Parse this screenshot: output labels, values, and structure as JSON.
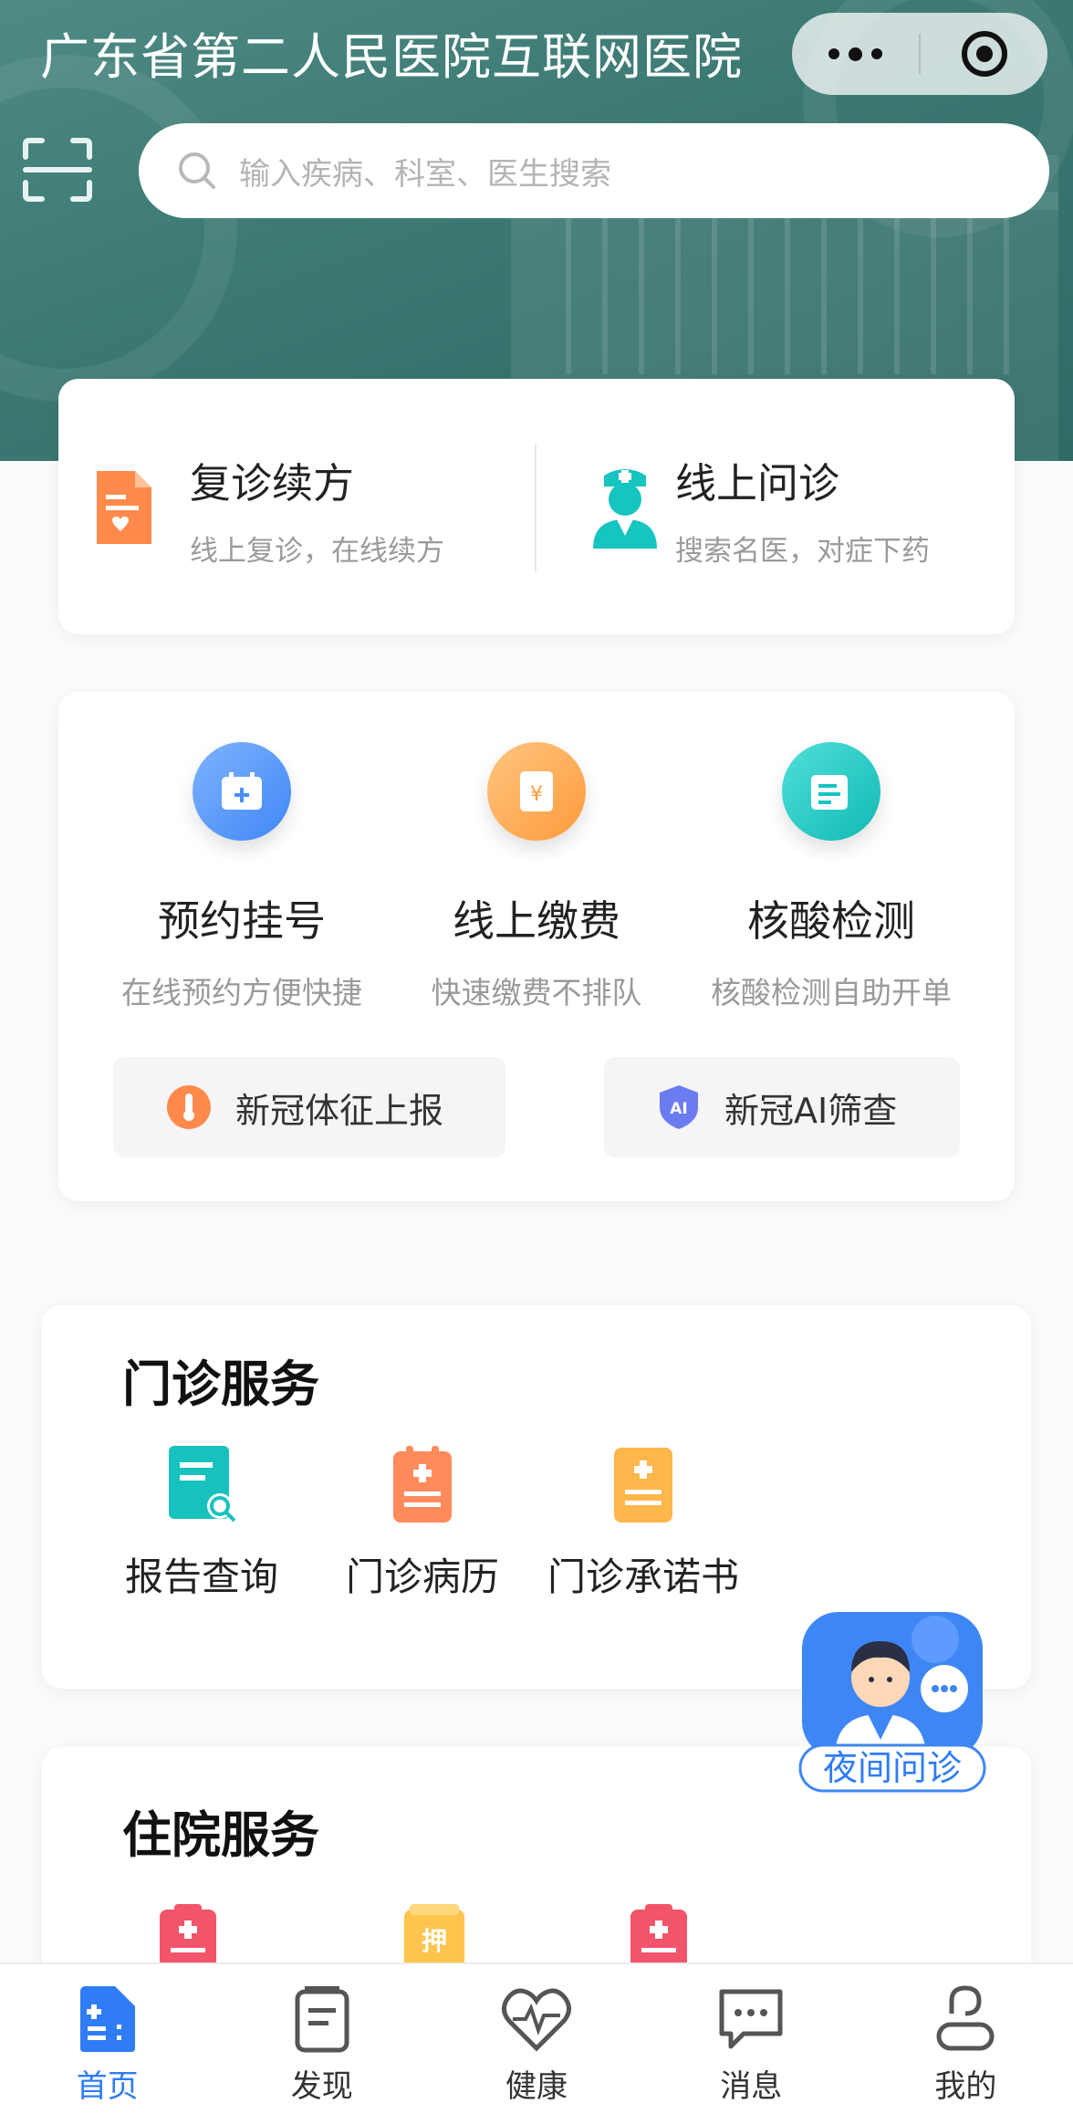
{
  "header": {
    "title": "广东省第二人民医院互联网医院",
    "search_placeholder": "输入疾病、科室、医生搜索"
  },
  "quick_entries": [
    {
      "title": "复诊续方",
      "subtitle": "线上复诊，在线续方",
      "icon": "prescription-doc-icon"
    },
    {
      "title": "线上问诊",
      "subtitle": "搜索名医，对症下药",
      "icon": "doctor-icon"
    }
  ],
  "services": [
    {
      "name": "预约挂号",
      "desc": "在线预约方便快捷",
      "icon": "calendar-plus-icon"
    },
    {
      "name": "线上缴费",
      "desc": "快速缴费不排队",
      "icon": "yuan-payment-icon"
    },
    {
      "name": "核酸检测",
      "desc": "核酸检测自助开单",
      "icon": "test-report-icon"
    }
  ],
  "pills": [
    {
      "label": "新冠体征上报",
      "icon": "thermometer-icon"
    },
    {
      "label": "新冠AI筛查",
      "icon": "ai-shield-icon"
    }
  ],
  "outpatient": {
    "title": "门诊服务",
    "items": [
      {
        "label": "报告查询",
        "icon": "report-search-icon"
      },
      {
        "label": "门诊病历",
        "icon": "medical-record-icon"
      },
      {
        "label": "门诊承诺书",
        "icon": "commitment-doc-icon"
      }
    ]
  },
  "inpatient": {
    "title": "住院服务",
    "items": [
      {
        "label": "",
        "icon": "inpatient-clipboard-icon"
      },
      {
        "label": "押",
        "icon": "deposit-icon"
      },
      {
        "label": "",
        "icon": "inpatient-clipboard-icon"
      }
    ]
  },
  "night_consult": {
    "label": "夜间问诊"
  },
  "tabs": [
    {
      "label": "首页",
      "icon": "home-icon",
      "active": true
    },
    {
      "label": "发现",
      "icon": "discover-icon",
      "active": false
    },
    {
      "label": "健康",
      "icon": "health-heart-icon",
      "active": false
    },
    {
      "label": "消息",
      "icon": "message-icon",
      "active": false
    },
    {
      "label": "我的",
      "icon": "profile-icon",
      "active": false
    }
  ],
  "colors": {
    "header_teal": "#3d7a74",
    "accent_blue": "#2f7cf6",
    "orange": "#ff9a3c",
    "teal": "#16c4c0",
    "red": "#f2556b"
  }
}
